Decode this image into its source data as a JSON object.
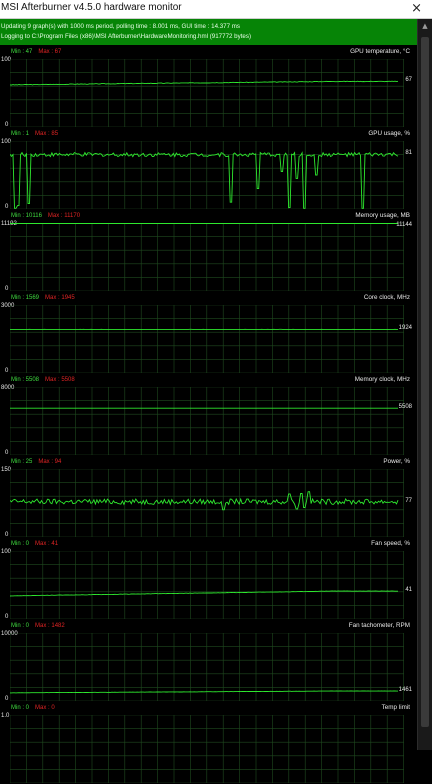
{
  "window": {
    "title": "MSI Afterburner v4.5.0 hardware monitor",
    "close_glyph": "×"
  },
  "status": {
    "line1": "Updating 9 graph(s) with 1000 ms period, polling time : 8.001 ms, GUI time : 14.377 ms",
    "line2": "Logging to C:\\Program Files (x86)\\MSI Afterburner\\HardwareMonitoring.hml (917772 bytes)"
  },
  "colors": {
    "graph_line": "#2ee82e",
    "grid": "#1f4a1f",
    "status_bg": "#068406",
    "min_text": "#3fdc3f",
    "max_text": "#e02424"
  },
  "graphs": [
    {
      "name": "GPU temperature, °C",
      "min": "Min : 47",
      "max": "Max : 67",
      "ytop": "100",
      "ybot": "0",
      "current": "67",
      "current_value": 67,
      "ymax": 100,
      "chart_data": {
        "type": "line",
        "trend": "ramp",
        "start": 62,
        "end": 67,
        "noise": 0.4
      }
    },
    {
      "name": "GPU usage, %",
      "min": "Min : 1",
      "max": "Max : 85",
      "ytop": "100",
      "ybot": "0",
      "current": "81",
      "current_value": 81,
      "ymax": 100,
      "chart_data": {
        "type": "line",
        "trend": "noisy",
        "base": 80,
        "noise": 3,
        "dips": [
          [
            0.015,
            1
          ],
          [
            0.02,
            5
          ],
          [
            0.05,
            8
          ],
          [
            0.57,
            10
          ],
          [
            0.64,
            30
          ],
          [
            0.7,
            55
          ],
          [
            0.72,
            2
          ],
          [
            0.74,
            45
          ],
          [
            0.76,
            1
          ],
          [
            0.79,
            50
          ],
          [
            0.91,
            1
          ]
        ]
      }
    },
    {
      "name": "Memory usage, MB",
      "min": "Min : 10116",
      "max": "Max : 11170",
      "ytop": "11192",
      "ybot": "0",
      "current": "11144",
      "current_value": 11144,
      "ymax": 11192,
      "chart_data": {
        "type": "line",
        "trend": "flat",
        "base": 11144,
        "noise": 0
      }
    },
    {
      "name": "Core clock, MHz",
      "min": "Min : 1569",
      "max": "Max : 1945",
      "ytop": "3000",
      "ybot": "0",
      "current": "1924",
      "current_value": 1924,
      "ymax": 3000,
      "chart_data": {
        "type": "line",
        "trend": "flat",
        "base": 1924,
        "noise": 2
      }
    },
    {
      "name": "Memory clock, MHz",
      "min": "Min : 5508",
      "max": "Max : 5508",
      "ytop": "8000",
      "ybot": "0",
      "current": "5508",
      "current_value": 5508,
      "ymax": 8000,
      "chart_data": {
        "type": "line",
        "trend": "flat",
        "base": 5508,
        "noise": 0
      }
    },
    {
      "name": "Power, %",
      "min": "Min : 25",
      "max": "Max : 94",
      "ytop": "150",
      "ybot": "0",
      "current": "77",
      "current_value": 77,
      "ymax": 150,
      "chart_data": {
        "type": "line",
        "trend": "noisy",
        "base": 78,
        "noise": 6,
        "dips": [
          [
            0.55,
            60
          ],
          [
            0.72,
            95
          ],
          [
            0.74,
            62
          ],
          [
            0.75,
            96
          ],
          [
            0.76,
            65
          ],
          [
            0.77,
            100
          ]
        ]
      }
    },
    {
      "name": "Fan speed, %",
      "min": "Min : 0",
      "max": "Max : 41",
      "ytop": "100",
      "ybot": "0",
      "current": "41",
      "current_value": 41,
      "ymax": 100,
      "chart_data": {
        "type": "line",
        "trend": "ramp",
        "start": 34,
        "end": 41,
        "noise": 0.2
      }
    },
    {
      "name": "Fan tachometer, RPM",
      "min": "Min : 0",
      "max": "Max : 1482",
      "ytop": "10000",
      "ybot": "0",
      "current": "1461",
      "current_value": 1461,
      "ymax": 10000,
      "chart_data": {
        "type": "line",
        "trend": "ramp",
        "start": 1200,
        "end": 1461,
        "noise": 10
      }
    },
    {
      "name": "Temp limit",
      "min": "Min : 0",
      "max": "Max : 0",
      "ytop": "1.0",
      "ybot": "",
      "current": "",
      "current_value": null,
      "ymax": 1,
      "chart_data": {
        "type": "line",
        "trend": "none"
      }
    }
  ]
}
